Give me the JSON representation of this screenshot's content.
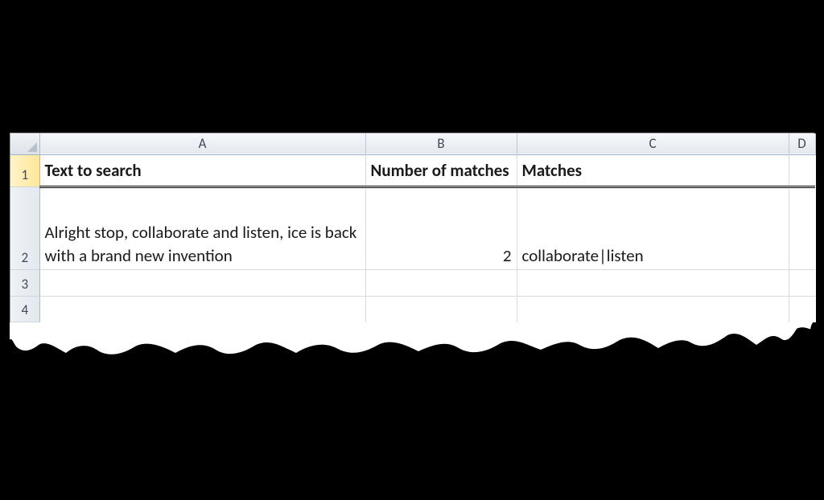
{
  "columns": {
    "A": "A",
    "B": "B",
    "C": "C",
    "D": "D"
  },
  "rows": {
    "r1": "1",
    "r2": "2",
    "r3": "3",
    "r4": "4"
  },
  "headers": {
    "A": "Text to search",
    "B": "Number of matches",
    "C": "Matches"
  },
  "data": {
    "r2": {
      "A": "Alright stop, collaborate and listen, ice is back with a brand new invention",
      "B": "2",
      "C": "collaborate|listen"
    }
  }
}
